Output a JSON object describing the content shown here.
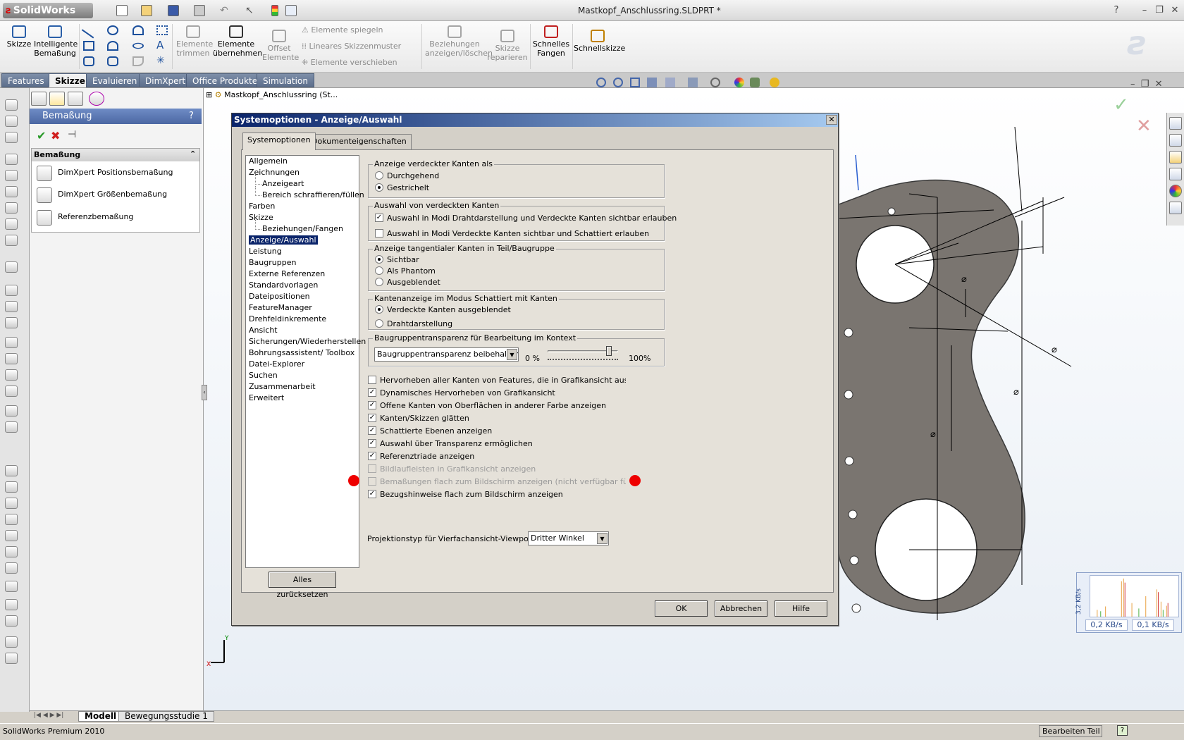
{
  "app": {
    "logo_text": "SolidWorks",
    "document_title": "Mastkopf_Anschlussring.SLDPRT *",
    "help_glyph": "?",
    "min_glyph": "–",
    "max_glyph": "❐",
    "close_glyph": "✕"
  },
  "ribbon": {
    "skizze": "Skizze",
    "intelligente_bemassung": "Intelligente Bemaßung",
    "elemente_trimmen": "Elemente trimmen",
    "elemente_uebernehmen": "Elemente übernehmen",
    "offset_elemente": "Offset Elemente",
    "elemente_spiegeln": "Elemente spiegeln",
    "lineares_skizzenmuster": "Lineares Skizzenmuster",
    "elemente_verschieben": "Elemente verschieben",
    "beziehungen": "Beziehungen anzeigen/löschen",
    "skizze_reparieren": "Skizze reparieren",
    "schnelles_fangen": "Schnelles Fangen",
    "schnellskizze": "Schnellskizze"
  },
  "command_tabs": [
    "Features",
    "Skizze",
    "Evaluieren",
    "DimXpert",
    "Office Produkte",
    "Simulation"
  ],
  "property_manager": {
    "title": "Bemaßung",
    "help": "?",
    "section_title": "Bemaßung",
    "items": [
      "DimXpert Positionsbemaßung",
      "DimXpert Größenbemaßung",
      "Referenzbemaßung"
    ]
  },
  "feature_tree_root": "Mastkopf_Anschlussring (St...",
  "dialog": {
    "title": "Systemoptionen - Anzeige/Auswahl",
    "tabs": [
      "Systemoptionen",
      "Dokumenteigenschaften"
    ],
    "categories": [
      "Allgemein",
      "Zeichnungen",
      "Anzeigeart",
      "Bereich schraffieren/füllen",
      "Farben",
      "Skizze",
      "Beziehungen/Fangen",
      "Anzeige/Auswahl",
      "Leistung",
      "Baugruppen",
      "Externe Referenzen",
      "Standardvorlagen",
      "Dateipositionen",
      "FeatureManager",
      "Drehfeldinkremente",
      "Ansicht",
      "Sicherungen/Wiederherstellen",
      "Bohrungsassistent/ Toolbox",
      "Datei-Explorer",
      "Suchen",
      "Zusammenarbeit",
      "Erweitert"
    ],
    "groups": {
      "verdeckte_kanten": {
        "caption": "Anzeige verdeckter Kanten als",
        "options": [
          "Durchgehend",
          "Gestrichelt"
        ]
      },
      "auswahl_verdeckt": {
        "caption": "Auswahl von verdeckten Kanten",
        "options": [
          "Auswahl in Modi Drahtdarstellung und Verdeckte Kanten sichtbar erlauben",
          "Auswahl in Modi Verdeckte Kanten sichtbar und Schattiert erlauben"
        ]
      },
      "tangential": {
        "caption": "Anzeige tangentialer Kanten in Teil/Baugruppe",
        "options": [
          "Sichtbar",
          "Als Phantom",
          "Ausgeblendet"
        ]
      },
      "kantenanzeige": {
        "caption": "Kantenanzeige im Modus Schattiert mit Kanten",
        "options": [
          "Verdeckte Kanten ausgeblendet",
          "Drahtdarstellung"
        ]
      },
      "transparenz": {
        "caption": "Baugruppentransparenz für Bearbeitung im Kontext",
        "combo": "Baugruppentransparenz beibehalten",
        "min": "0 %",
        "max": "100%",
        "slider_fraction": 0.9
      }
    },
    "checkboxes": [
      {
        "label": "Hervorheben aller Kanten von Features, die in Grafikansicht ausgewählt sind",
        "checked": false,
        "disabled": false
      },
      {
        "label": "Dynamisches Hervorheben von Grafikansicht",
        "checked": true,
        "disabled": false
      },
      {
        "label": "Offene Kanten von Oberflächen in anderer Farbe anzeigen",
        "checked": true,
        "disabled": false
      },
      {
        "label": "Kanten/Skizzen glätten",
        "checked": true,
        "disabled": false
      },
      {
        "label": "Schattierte Ebenen anzeigen",
        "checked": true,
        "disabled": false
      },
      {
        "label": "Auswahl über Transparenz ermöglichen",
        "checked": true,
        "disabled": false
      },
      {
        "label": "Referenztriade anzeigen",
        "checked": true,
        "disabled": false
      },
      {
        "label": "Bildlaufleisten in Grafikansicht anzeigen",
        "checked": false,
        "disabled": true
      },
      {
        "label": "Bemaßungen flach zum Bildschirm anzeigen (nicht verfügbar für DimXpe",
        "checked": false,
        "disabled": true
      },
      {
        "label": "Bezugshinweise flach zum Bildschirm anzeigen",
        "checked": true,
        "disabled": false
      }
    ],
    "projection_label": "Projektionstyp für Vierfachansicht-Viewport:",
    "projection_value": "Dritter Winkel",
    "reset_button": "Alles zurücksetzen",
    "ok": "OK",
    "cancel": "Abbrechen",
    "help": "Hilfe"
  },
  "network_monitor": {
    "axis": "3,2 KB/s",
    "down": "0,2 KB/s",
    "up": "0,1 KB/s"
  },
  "bottom_tabs": [
    "Modell",
    "Bewegungsstudie 1"
  ],
  "status": {
    "left": "SolidWorks Premium 2010",
    "right": "Bearbeiten Teil"
  },
  "colors": {
    "dialog_title": "#0a246a",
    "accent_red": "#e00000",
    "part_fill": "#7a7570"
  }
}
